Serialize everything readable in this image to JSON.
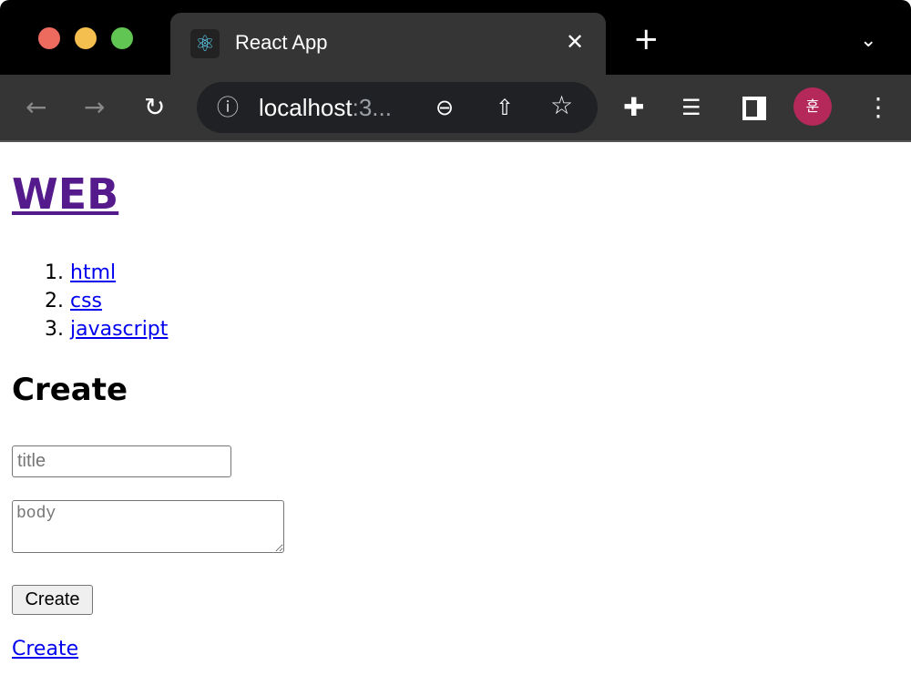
{
  "browser": {
    "tab_title": "React App",
    "url_host": "localhost",
    "url_rest": ":3...",
    "avatar_letter": "훈"
  },
  "page": {
    "heading": "WEB",
    "topics": [
      "html",
      "css",
      "javascript"
    ],
    "form_heading": "Create",
    "title_placeholder": "title",
    "body_placeholder": "body",
    "submit_label": "Create",
    "create_link": "Create"
  },
  "colors": {
    "visited_link": "#551a8b",
    "link": "#0000ee",
    "avatar": "#b5295a"
  }
}
